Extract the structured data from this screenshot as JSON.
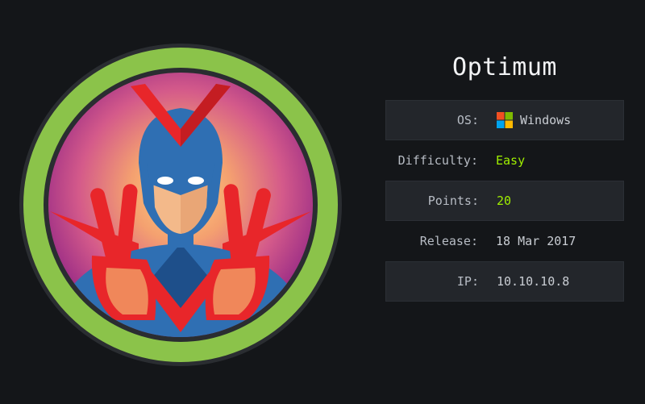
{
  "machine": {
    "name": "Optimum",
    "avatar_alt": "superhero-avatar"
  },
  "info": {
    "os_label": "OS:",
    "os_value": "Windows",
    "os_icon": "windows-logo-icon",
    "difficulty_label": "Difficulty:",
    "difficulty_value": "Easy",
    "points_label": "Points:",
    "points_value": "20",
    "release_label": "Release:",
    "release_value": "18 Mar 2017",
    "ip_label": "IP:",
    "ip_value": "10.10.10.8"
  },
  "colors": {
    "background": "#141619",
    "ring_green": "#8bc34a",
    "accent_green": "#9fef00",
    "row_shade": "#23262b",
    "win_red": "#f25022",
    "win_green": "#7fba00",
    "win_blue": "#00a4ef",
    "win_yellow": "#ffb900"
  }
}
